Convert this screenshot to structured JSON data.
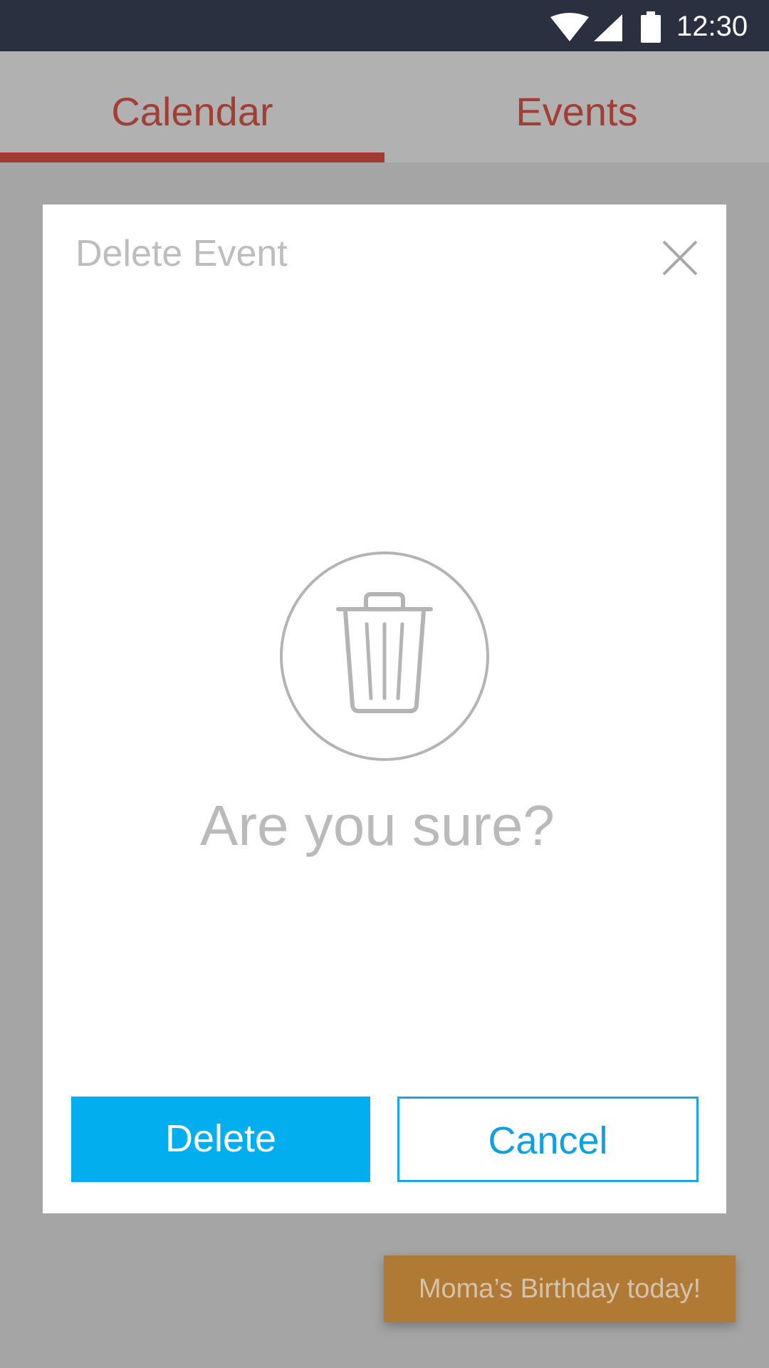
{
  "status_bar": {
    "time": "12:30",
    "icons": [
      "wifi-icon",
      "signal-icon",
      "battery-icon"
    ]
  },
  "tabs": [
    {
      "label": "Calendar",
      "active": true
    },
    {
      "label": "Events",
      "active": false
    }
  ],
  "dialog": {
    "title": "Delete Event",
    "close_icon": "close-icon",
    "illustration_icon": "trash-icon",
    "prompt": "Are you sure?",
    "delete_label": "Delete",
    "cancel_label": "Cancel"
  },
  "toast": {
    "message": "Moma’s Birthday today!"
  },
  "colors": {
    "status_bar_bg": "#2b3041",
    "tab_text": "#a33e35",
    "tab_indicator": "#a23a32",
    "primary_button": "#02aeee",
    "secondary_button_text": "#109fdf",
    "toast_bg": "#b07934",
    "overlay_bg": "#a5a5a5"
  }
}
